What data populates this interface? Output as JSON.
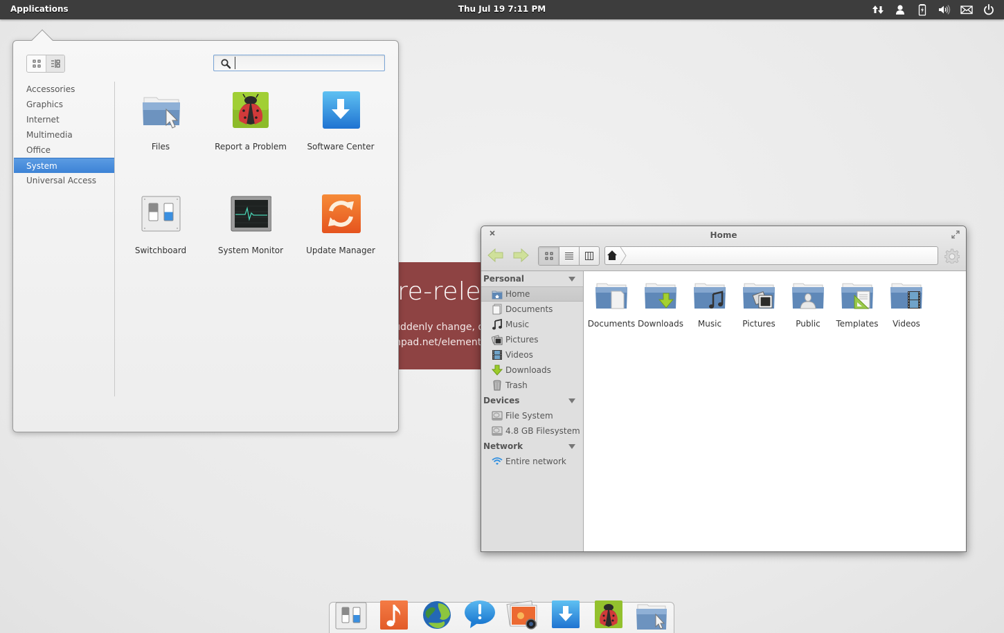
{
  "panel": {
    "applications_label": "Applications",
    "clock": "Thu Jul 19  7:11 PM",
    "indicators": [
      {
        "name": "network-icon"
      },
      {
        "name": "user-icon"
      },
      {
        "name": "battery-icon"
      },
      {
        "name": "volume-icon"
      },
      {
        "name": "mail-icon"
      },
      {
        "name": "power-icon"
      }
    ]
  },
  "notice": {
    "title": "This is a pre-release",
    "line1": "What you're seeing may suddenly change, d",
    "line2": "report them at bugs.launchpad.net/element"
  },
  "slingshot": {
    "view_modes": [
      {
        "name": "grid-view",
        "active": false
      },
      {
        "name": "category-view",
        "active": true
      }
    ],
    "search": {
      "value": "",
      "placeholder": ""
    },
    "categories": [
      {
        "label": "Accessories",
        "active": false
      },
      {
        "label": "Graphics",
        "active": false
      },
      {
        "label": "Internet",
        "active": false
      },
      {
        "label": "Multimedia",
        "active": false
      },
      {
        "label": "Office",
        "active": false
      },
      {
        "label": "System",
        "active": true
      },
      {
        "label": "Universal Access",
        "active": false
      }
    ],
    "apps": [
      {
        "label": "Files",
        "icon": "files-icon"
      },
      {
        "label": "Report a Problem",
        "icon": "ladybug-icon"
      },
      {
        "label": "Software Center",
        "icon": "software-center-icon"
      },
      {
        "label": "Switchboard",
        "icon": "switchboard-icon"
      },
      {
        "label": "System Monitor",
        "icon": "system-monitor-icon"
      },
      {
        "label": "Update Manager",
        "icon": "update-manager-icon"
      }
    ]
  },
  "files_window": {
    "title": "Home",
    "view_modes": [
      {
        "name": "icon-view",
        "active": true
      },
      {
        "name": "list-view",
        "active": false
      },
      {
        "name": "column-view",
        "active": false
      }
    ],
    "path": [
      "Home"
    ],
    "sidebar": {
      "sections": [
        {
          "title": "Personal",
          "items": [
            {
              "label": "Home",
              "icon": "home-folder-icon",
              "active": true
            },
            {
              "label": "Documents",
              "icon": "documents-icon",
              "active": false
            },
            {
              "label": "Music",
              "icon": "music-icon",
              "active": false
            },
            {
              "label": "Pictures",
              "icon": "pictures-icon",
              "active": false
            },
            {
              "label": "Videos",
              "icon": "videos-icon",
              "active": false
            },
            {
              "label": "Downloads",
              "icon": "downloads-icon",
              "active": false
            },
            {
              "label": "Trash",
              "icon": "trash-icon",
              "active": false
            }
          ]
        },
        {
          "title": "Devices",
          "items": [
            {
              "label": "File System",
              "icon": "drive-icon",
              "active": false
            },
            {
              "label": "4.8 GB Filesystem",
              "icon": "drive-icon",
              "active": false
            }
          ]
        },
        {
          "title": "Network",
          "items": [
            {
              "label": "Entire network",
              "icon": "wifi-icon",
              "active": false
            }
          ]
        }
      ]
    },
    "folders": [
      {
        "label": "Documents",
        "emblem": "document"
      },
      {
        "label": "Downloads",
        "emblem": "download"
      },
      {
        "label": "Music",
        "emblem": "music"
      },
      {
        "label": "Pictures",
        "emblem": "pictures"
      },
      {
        "label": "Public",
        "emblem": "person"
      },
      {
        "label": "Templates",
        "emblem": "template"
      },
      {
        "label": "Videos",
        "emblem": "film"
      }
    ]
  },
  "dock": {
    "items": [
      {
        "name": "switchboard"
      },
      {
        "name": "music-player"
      },
      {
        "name": "web-browser"
      },
      {
        "name": "notifications"
      },
      {
        "name": "photo-viewer"
      },
      {
        "name": "software-center"
      },
      {
        "name": "report-a-problem"
      },
      {
        "name": "files"
      }
    ]
  },
  "colors": {
    "accent": "#3d83d6",
    "panel": "#3d3d3d",
    "notice_red": "#8e4343"
  }
}
